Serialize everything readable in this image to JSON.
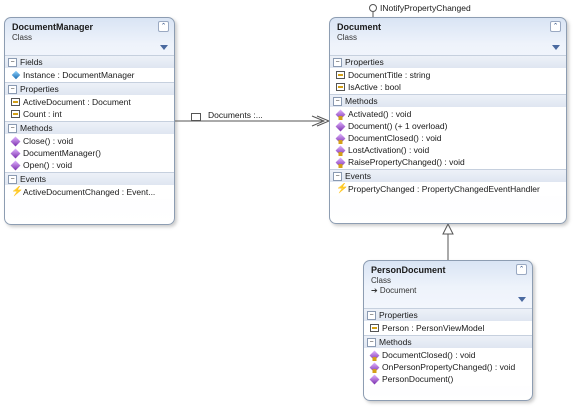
{
  "interface_label": "INotifyPropertyChanged",
  "association_label": "Documents :...",
  "icons": {
    "class_collapse": "double-chevron-up-icon",
    "filter": "filter-funnel-icon",
    "section_toggle": "minus-box-icon",
    "property": "property-icon",
    "method": "method-icon",
    "field": "field-icon",
    "event": "event-lightning-icon"
  },
  "document_manager": {
    "name": "DocumentManager",
    "kind": "Class",
    "fields_label": "Fields",
    "fields": [
      "Instance : DocumentManager"
    ],
    "properties_label": "Properties",
    "properties": [
      "ActiveDocument : Document",
      "Count : int"
    ],
    "methods_label": "Methods",
    "methods": [
      "Close() : void",
      "DocumentManager()",
      "Open() : void"
    ],
    "events_label": "Events",
    "events": [
      "ActiveDocumentChanged : Event..."
    ]
  },
  "document": {
    "name": "Document",
    "kind": "Class",
    "properties_label": "Properties",
    "properties": [
      "DocumentTitle : string",
      "IsActive : bool"
    ],
    "methods_label": "Methods",
    "methods": [
      "Activated() : void",
      "Document() (+ 1 overload)",
      "DocumentClosed() : void",
      "LostActivation() : void",
      "RaisePropertyChanged() : void"
    ],
    "events_label": "Events",
    "events": [
      "PropertyChanged : PropertyChangedEventHandler"
    ]
  },
  "person_document": {
    "name": "PersonDocument",
    "kind": "Class",
    "base": "➔ Document",
    "properties_label": "Properties",
    "properties": [
      "Person : PersonViewModel"
    ],
    "methods_label": "Methods",
    "methods": [
      "DocumentClosed() : void",
      "OnPersonPropertyChanged() : void",
      "PersonDocument()"
    ]
  }
}
